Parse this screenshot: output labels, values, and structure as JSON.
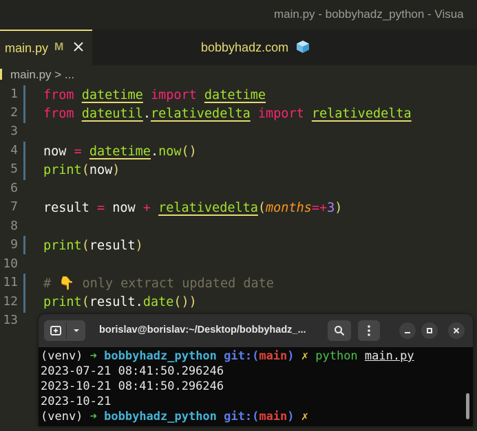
{
  "window": {
    "title": "main.py - bobbyhadz_python - Visua"
  },
  "tab": {
    "name": "main.py",
    "modified": "M"
  },
  "center_title": "bobbyhadz.com",
  "breadcrumb": {
    "file": "main.py",
    "rest": " > ..."
  },
  "editor": {
    "line_numbers": [
      "1",
      "2",
      "3",
      "4",
      "5",
      "6",
      "7",
      "8",
      "9",
      "10",
      "11",
      "12",
      "13"
    ],
    "tokens": {
      "from": "from",
      "import": "import",
      "datetime": "datetime",
      "dateutil": "dateutil",
      "dot": ".",
      "relativedelta": "relativedelta",
      "now": "now",
      "eq": " = ",
      "lp": "(",
      "rp": ")",
      "print": "print",
      "result": "result",
      "plus": " + ",
      "months": "months",
      "eqplus": "=+",
      "three": "3",
      "date": "date",
      "hash": "# ",
      "hand": "👇",
      "comment": " only extract updated date",
      "space": " "
    }
  },
  "terminal": {
    "title": "borislav@borislav:~/Desktop/bobbyhadz_...",
    "prompt": {
      "venv": "(venv) ",
      "arrow": "➜ ",
      "dir": "bobbyhadz_python",
      "git": " git:(",
      "branch": "main",
      "gitclose": ")",
      "x": " ✗ ",
      "cmd": "python ",
      "file": "main.py"
    },
    "output": [
      "2023-07-21 08:41:50.296246",
      "2023-10-21 08:41:50.296246",
      "2023-10-21"
    ]
  }
}
